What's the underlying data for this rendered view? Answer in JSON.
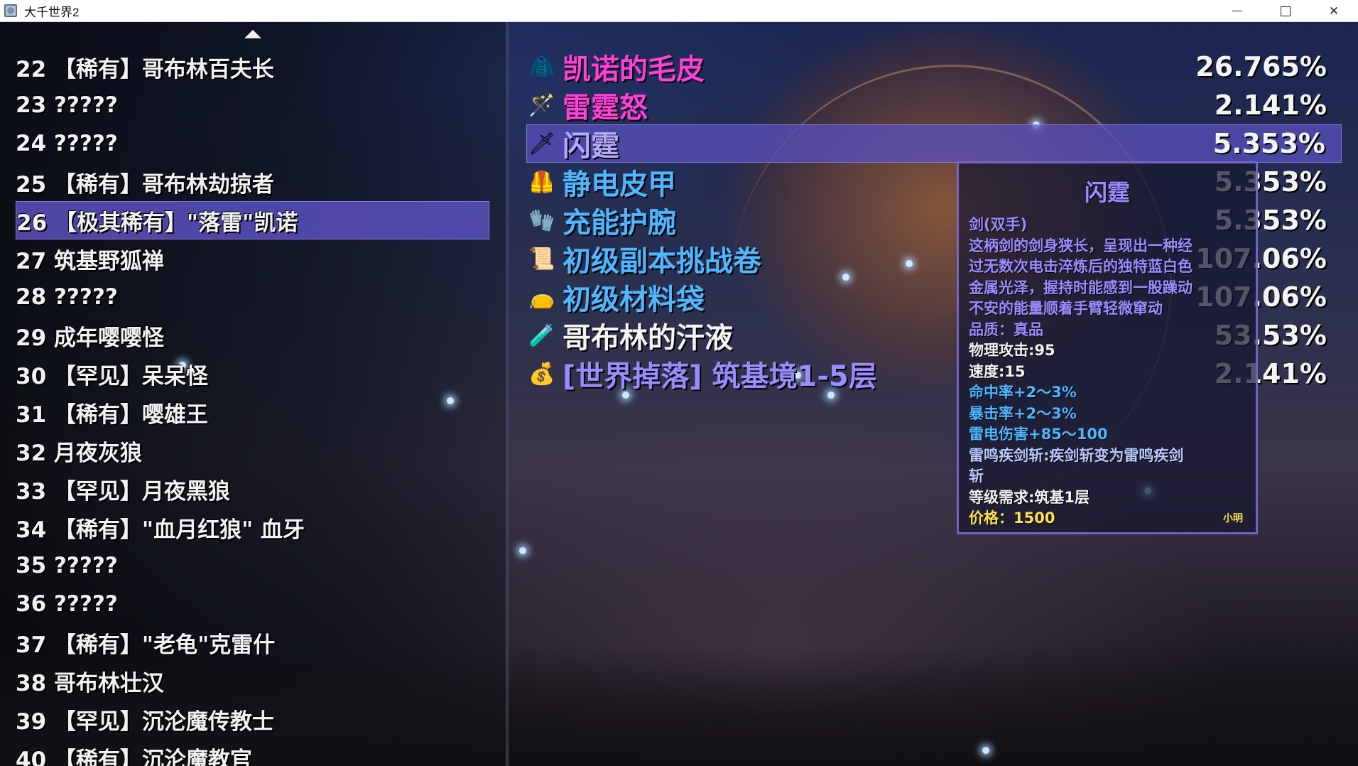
{
  "window": {
    "title": "大千世界2"
  },
  "monster_list": {
    "items": [
      {
        "label": "22 【稀有】哥布林百夫长"
      },
      {
        "label": "23 ?????"
      },
      {
        "label": "24 ?????"
      },
      {
        "label": "25 【稀有】哥布林劫掠者"
      },
      {
        "label": "26 【极其稀有】\"落雷\"凯诺",
        "selected": true
      },
      {
        "label": "27 筑基野狐禅"
      },
      {
        "label": "28 ?????"
      },
      {
        "label": "29 成年嘤嘤怪"
      },
      {
        "label": "30 【罕见】呆呆怪"
      },
      {
        "label": "31 【稀有】嘤雄王"
      },
      {
        "label": "32 月夜灰狼"
      },
      {
        "label": "33 【罕见】月夜黑狼"
      },
      {
        "label": "34 【稀有】\"血月红狼\" 血牙"
      },
      {
        "label": "35 ?????"
      },
      {
        "label": "36 ?????"
      },
      {
        "label": "37 【稀有】\"老龟\"克雷什"
      },
      {
        "label": "38 哥布林壮汉"
      },
      {
        "label": "39 【罕见】沉沦魔传教士"
      },
      {
        "label": "40 【稀有】沉沦魔教官"
      }
    ]
  },
  "drop_table": {
    "rows": [
      {
        "name": "凯诺的毛皮",
        "rate": "26.765%",
        "color": "#ff3fd9",
        "icon": "hide-icon",
        "glyph": "🧥"
      },
      {
        "name": "雷霆怒",
        "rate": "2.141%",
        "color": "#ff3fd9",
        "icon": "club-icon",
        "glyph": "🪄"
      },
      {
        "name": "闪霆",
        "rate": "5.353%",
        "color": "#b4a8ff",
        "icon": "sword-icon",
        "glyph": "🗡",
        "selected": true
      },
      {
        "name": "静电皮甲",
        "rate": "5.353%",
        "color": "#4fb6ff",
        "icon": "leather-armor-icon",
        "glyph": "🦺"
      },
      {
        "name": "充能护腕",
        "rate": "5.353%",
        "color": "#4fb6ff",
        "icon": "bracer-icon",
        "glyph": "🧤"
      },
      {
        "name": "初级副本挑战卷",
        "rate": "107.06%",
        "color": "#4fb6ff",
        "icon": "scroll-icon",
        "glyph": "📜"
      },
      {
        "name": "初级材料袋",
        "rate": "107.06%",
        "color": "#4fb6ff",
        "icon": "bag-icon",
        "glyph": "👝"
      },
      {
        "name": "哥布林的汗液",
        "rate": "53.53%",
        "color": "#f4f4f4",
        "icon": "vial-icon",
        "glyph": "🧪"
      },
      {
        "name": "[世界掉落] 筑基境1-5层",
        "rate": "2.141%",
        "color": "#9a8cff",
        "icon": "loot-sack-icon",
        "glyph": "💰"
      }
    ]
  },
  "tooltip": {
    "title": "闪霆",
    "lines": [
      {
        "text": "剑(双手)",
        "style": "purple"
      },
      {
        "text": "这柄剑的剑身狭长，呈现出一种经",
        "style": "purple"
      },
      {
        "text": "过无数次电击淬炼后的独特蓝白色",
        "style": "purple"
      },
      {
        "text": "金属光泽，握持时能感到一股躁动",
        "style": "purple"
      },
      {
        "text": "不安的能量顺着手臂轻微窜动",
        "style": "purple"
      },
      {
        "text": "品质：真品",
        "style": "purple"
      },
      {
        "text": "物理攻击:95",
        "style": "white"
      },
      {
        "text": "速度:15",
        "style": "white"
      },
      {
        "text": "命中率+2～3%",
        "style": "cyan"
      },
      {
        "text": "暴击率+2～3%",
        "style": "cyan"
      },
      {
        "text": "雷电伤害+85～100",
        "style": "cyan"
      },
      {
        "text": "雷鸣疾剑斩:疾剑斩变为雷鸣疾剑",
        "style": "skill"
      },
      {
        "text": "斩",
        "style": "skill"
      },
      {
        "text": "等级需求:筑基1层",
        "style": "white"
      },
      {
        "text": "价格：1500",
        "style": "gold"
      }
    ],
    "author": "小明"
  }
}
